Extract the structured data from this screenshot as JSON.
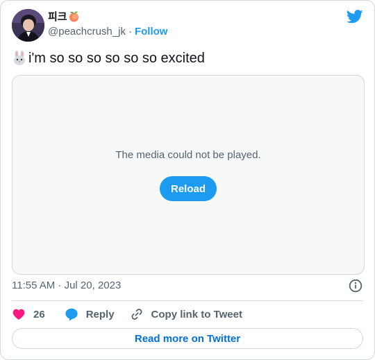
{
  "author": {
    "display_name": "피크",
    "handle": "@peachcrush_jk",
    "separator": "·",
    "follow_label": "Follow"
  },
  "tweet": {
    "text": "i'm so so so so so so excited"
  },
  "media": {
    "message": "The media could not be played.",
    "reload_label": "Reload"
  },
  "meta": {
    "timestamp": "11:55 AM · Jul 20, 2023"
  },
  "actions": {
    "like_count": "26",
    "reply_label": "Reply",
    "copy_link_label": "Copy link to Tweet"
  },
  "footer": {
    "read_more_label": "Read more on Twitter"
  },
  "colors": {
    "accent": "#1d9bf0",
    "like": "#f91880",
    "link": "#006fd6",
    "muted": "#536471"
  },
  "icons": [
    "twitter-bird-icon",
    "rabbit-face-icon",
    "peach-icon",
    "info-icon",
    "heart-icon",
    "reply-bubble-icon",
    "link-icon"
  ]
}
